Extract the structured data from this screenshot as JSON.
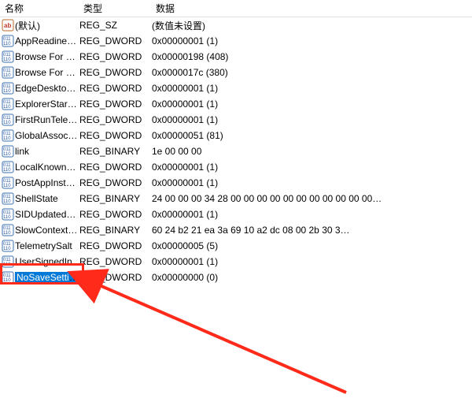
{
  "columns": {
    "name": "名称",
    "type": "类型",
    "data": "数据"
  },
  "rows": [
    {
      "icon": "sz",
      "name": "(默认)",
      "type": "REG_SZ",
      "data": "(数值未设置)"
    },
    {
      "icon": "bin",
      "name": "AppReadiness…",
      "type": "REG_DWORD",
      "data": "0x00000001 (1)"
    },
    {
      "icon": "bin",
      "name": "Browse For Fol…",
      "type": "REG_DWORD",
      "data": "0x00000198 (408)"
    },
    {
      "icon": "bin",
      "name": "Browse For Fol…",
      "type": "REG_DWORD",
      "data": "0x0000017c (380)"
    },
    {
      "icon": "bin",
      "name": "EdgeDesktopS…",
      "type": "REG_DWORD",
      "data": "0x00000001 (1)"
    },
    {
      "icon": "bin",
      "name": "ExplorerStartu…",
      "type": "REG_DWORD",
      "data": "0x00000001 (1)"
    },
    {
      "icon": "bin",
      "name": "FirstRunTelem…",
      "type": "REG_DWORD",
      "data": "0x00000001 (1)"
    },
    {
      "icon": "bin",
      "name": "GlobalAssocCh…",
      "type": "REG_DWORD",
      "data": "0x00000051 (81)"
    },
    {
      "icon": "bin",
      "name": "link",
      "type": "REG_BINARY",
      "data": "1e 00 00 00"
    },
    {
      "icon": "bin",
      "name": "LocalKnownFol…",
      "type": "REG_DWORD",
      "data": "0x00000001 (1)"
    },
    {
      "icon": "bin",
      "name": "PostAppInstall…",
      "type": "REG_DWORD",
      "data": "0x00000001 (1)"
    },
    {
      "icon": "bin",
      "name": "ShellState",
      "type": "REG_BINARY",
      "data": "24 00 00 00 34 28 00 00 00 00 00 00 00 00 00 00 00…"
    },
    {
      "icon": "bin",
      "name": "SIDUpdatedO…",
      "type": "REG_DWORD",
      "data": "0x00000001 (1)"
    },
    {
      "icon": "bin",
      "name": "SlowContextM…",
      "type": "REG_BINARY",
      "data": "60 24 b2 21 ea 3a 69 10 a2 dc 08 00 2b 30 3…"
    },
    {
      "icon": "bin",
      "name": "TelemetrySalt",
      "type": "REG_DWORD",
      "data": "0x00000005 (5)"
    },
    {
      "icon": "bin",
      "name": "UserSignedIn",
      "type": "REG_DWORD",
      "data": "0x00000001 (1)"
    },
    {
      "icon": "bin",
      "name": "NoSaveSettings",
      "type": "REG_DWORD",
      "data": "0x00000000 (0)",
      "selected": true
    }
  ],
  "annotation": {
    "highlight_target": "NoSaveSettings"
  }
}
